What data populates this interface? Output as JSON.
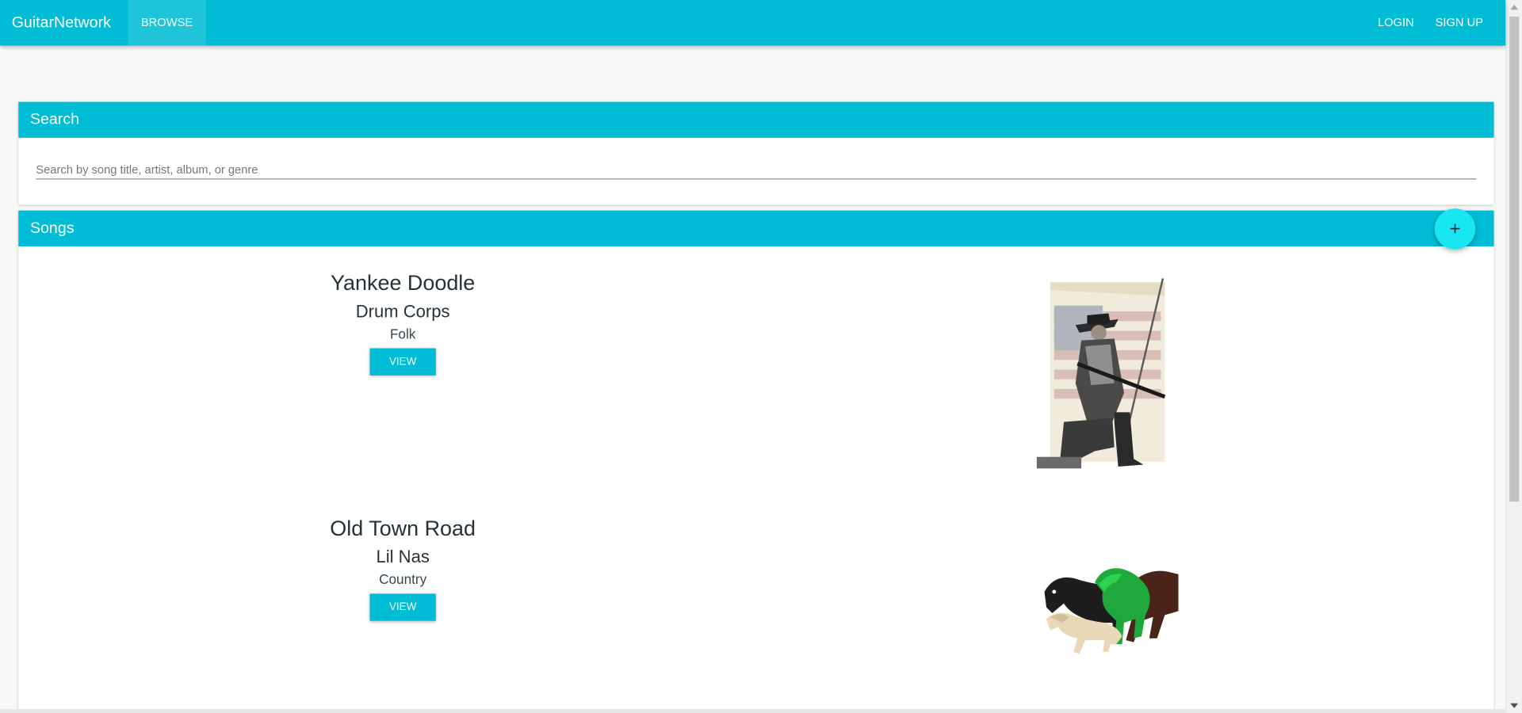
{
  "navbar": {
    "brand": "GuitarNetwork",
    "browse": "BROWSE",
    "login": "LOGIN",
    "signup": "SIGN UP"
  },
  "search": {
    "title": "Search",
    "placeholder": "Search by song title, artist, album, or genre",
    "value": ""
  },
  "songs": {
    "title": "Songs",
    "add_icon": "plus-icon",
    "add_label": "+",
    "items": [
      {
        "title": "Yankee Doodle",
        "artist": "Drum Corps",
        "genre": "Folk",
        "view_label": "VIEW",
        "image": "minuteman-with-flag-image"
      },
      {
        "title": "Old Town Road",
        "artist": "Lil Nas",
        "genre": "Country",
        "view_label": "VIEW",
        "image": "running-horses-image"
      }
    ]
  },
  "colors": {
    "primary": "#00bcd4",
    "fab": "#18e6f0",
    "background": "#f8f8f8"
  }
}
